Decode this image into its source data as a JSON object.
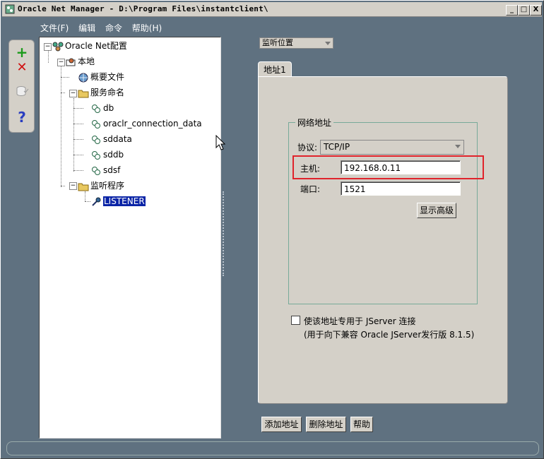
{
  "window": {
    "title": "Oracle Net Manager - D:\\Program Files\\instantclient\\",
    "controls": [
      "_",
      "□",
      "X"
    ]
  },
  "menu": [
    "文件(F)",
    "编辑",
    "命令",
    "帮助(H)"
  ],
  "toolbar": [
    {
      "icon": "plus-icon",
      "symbol": "+"
    },
    {
      "icon": "x-icon",
      "symbol": "✕"
    },
    {
      "icon": "database-check-icon",
      "symbol": ""
    },
    {
      "icon": "help-icon",
      "symbol": "?"
    }
  ],
  "tree": {
    "root": "Oracle Net配置",
    "local": "本地",
    "profile": "概要文件",
    "service_naming": "服务命名",
    "services": [
      "db",
      "oraclr_connection_data",
      "sddata",
      "sddb",
      "sdsf"
    ],
    "listeners": "监听程序",
    "listener": "LISTENER"
  },
  "view_select": "监听位置",
  "tab": "地址1",
  "network_address": {
    "group_title": "网络地址",
    "protocol_label": "协议:",
    "protocol_value": "TCP/IP",
    "host_label": "主机:",
    "host_value": "192.168.0.11",
    "port_label": "端口:",
    "port_value": "1521",
    "advanced_button": "显示高级"
  },
  "jserver": {
    "checkbox_label": "使该地址专用于 JServer 连接",
    "note": "(用于向下兼容 Oracle JServer发行版 8.1.5)"
  },
  "buttons": {
    "add": "添加地址",
    "delete": "删除地址",
    "help": "帮助"
  },
  "colors": {
    "highlight_box": "#e0232b",
    "selection": "#0a24a6",
    "background": "#5f7180"
  }
}
